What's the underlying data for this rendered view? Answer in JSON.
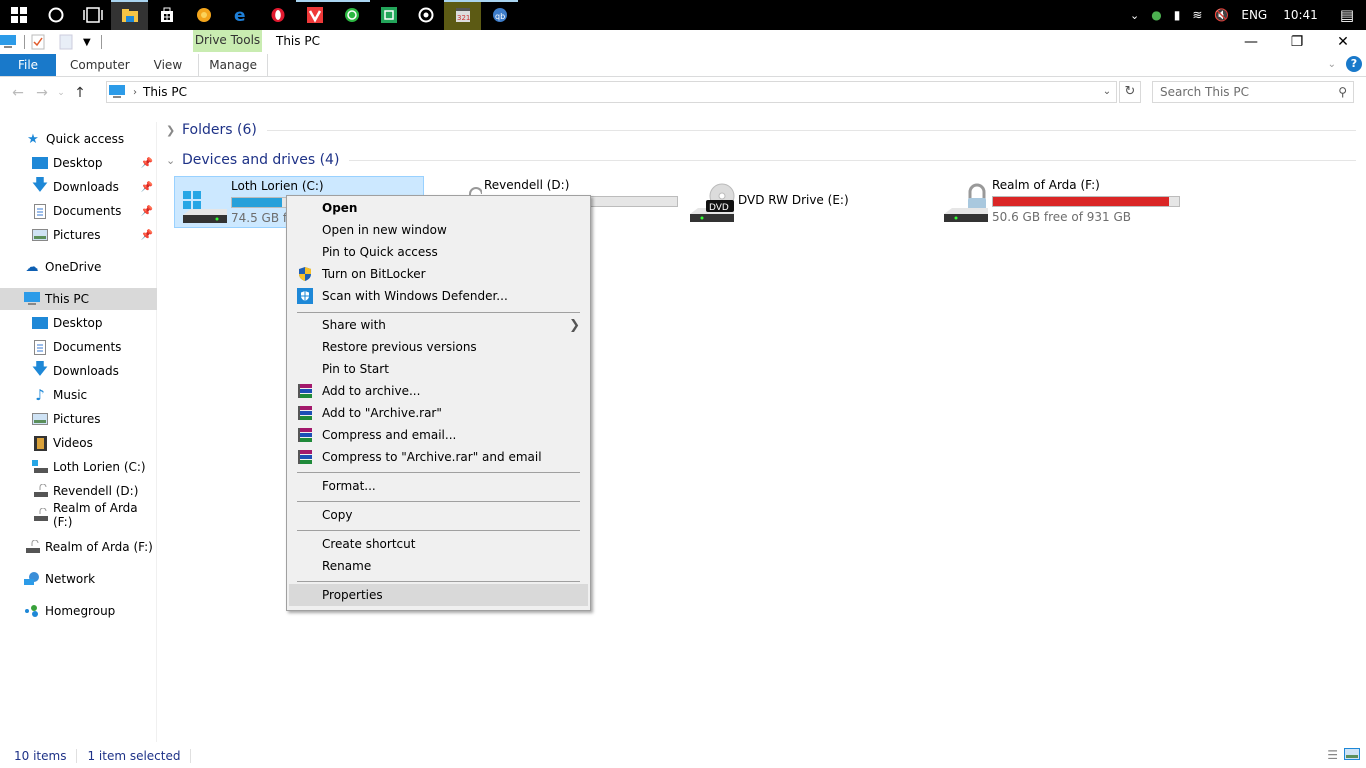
{
  "taskbar": {
    "apps": [
      {
        "name": "start",
        "icon": "windows-logo-icon"
      },
      {
        "name": "cortana",
        "icon": "cortana-circle-icon"
      },
      {
        "name": "task-view",
        "icon": "task-view-icon"
      },
      {
        "name": "file-explorer",
        "icon": "folder-icon",
        "active": true
      },
      {
        "name": "store",
        "icon": "store-bag-icon"
      },
      {
        "name": "chrome-canary",
        "icon": "chrome-canary-icon"
      },
      {
        "name": "edge",
        "icon": "edge-icon"
      },
      {
        "name": "opera",
        "icon": "opera-icon"
      },
      {
        "name": "vivaldi",
        "icon": "vivaldi-icon",
        "running": true
      },
      {
        "name": "whatsapp",
        "icon": "whatsapp-icon",
        "running": true
      },
      {
        "name": "app-green",
        "icon": "green-app-icon"
      },
      {
        "name": "groove",
        "icon": "groove-music-icon"
      },
      {
        "name": "media-player-classic",
        "icon": "mpc-icon",
        "running": true
      },
      {
        "name": "qbittorrent",
        "icon": "qbittorrent-icon",
        "running": true
      }
    ],
    "tray": {
      "language": "ENG",
      "time": "10:41"
    }
  },
  "window": {
    "title": "This PC",
    "contextual_tab_group": "Drive Tools",
    "ribbon_tabs": [
      "File",
      "Computer",
      "View",
      "Manage"
    ],
    "address_path": "This PC",
    "search_placeholder": "Search This PC"
  },
  "sidebar": {
    "quick_access": {
      "label": "Quick access"
    },
    "quick_items": [
      {
        "label": "Desktop",
        "pinned": true
      },
      {
        "label": "Downloads",
        "pinned": true
      },
      {
        "label": "Documents",
        "pinned": true
      },
      {
        "label": "Pictures",
        "pinned": true
      }
    ],
    "onedrive": "OneDrive",
    "this_pc": "This PC",
    "pc_items": [
      {
        "label": "Desktop"
      },
      {
        "label": "Documents"
      },
      {
        "label": "Downloads"
      },
      {
        "label": "Music"
      },
      {
        "label": "Pictures"
      },
      {
        "label": "Videos"
      },
      {
        "label": "Loth Lorien (C:)"
      },
      {
        "label": "Revendell (D:)"
      },
      {
        "label": "Realm of Arda (F:)"
      }
    ],
    "removable": "Realm of Arda (F:)",
    "network": "Network",
    "homegroup": "Homegroup"
  },
  "content": {
    "folders_header": "Folders (6)",
    "devices_header": "Devices and drives (4)",
    "drives": [
      {
        "name": "Loth Lorien (C:)",
        "free_text": "74.5 GB free of ...",
        "used_fraction": 0.26,
        "selected": true,
        "bar_color": "#26a0da"
      },
      {
        "name": "Revendell (D:)",
        "free_text": "...B",
        "used_fraction": 0.0,
        "selected": false,
        "bar_color": "#26a0da"
      },
      {
        "name": "DVD RW Drive (E:)",
        "free_text": "",
        "selected": false
      },
      {
        "name": "Realm of Arda (F:)",
        "free_text": "50.6 GB free of 931 GB",
        "used_fraction": 0.946,
        "selected": false,
        "bar_color": "#da2626"
      }
    ]
  },
  "context_menu": {
    "items": [
      {
        "label": "Open",
        "bold": true
      },
      {
        "label": "Open in new window"
      },
      {
        "label": "Pin to Quick access"
      },
      {
        "label": "Turn on BitLocker",
        "icon": "uac-shield-icon"
      },
      {
        "label": "Scan with Windows Defender...",
        "icon": "defender-icon"
      },
      {
        "label": "Share with",
        "submenu": true
      },
      {
        "label": "Restore previous versions"
      },
      {
        "label": "Pin to Start"
      },
      {
        "label": "Add to archive...",
        "icon": "winrar-icon"
      },
      {
        "label": "Add to \"Archive.rar\"",
        "icon": "winrar-icon"
      },
      {
        "label": "Compress and email...",
        "icon": "winrar-icon"
      },
      {
        "label": "Compress to \"Archive.rar\" and email",
        "icon": "winrar-icon"
      },
      {
        "label": "Format..."
      },
      {
        "label": "Copy"
      },
      {
        "label": "Create shortcut"
      },
      {
        "label": "Rename"
      },
      {
        "label": "Properties",
        "highlighted": true
      }
    ]
  },
  "statusbar": {
    "item_count": "10 items",
    "selection": "1 item selected"
  }
}
